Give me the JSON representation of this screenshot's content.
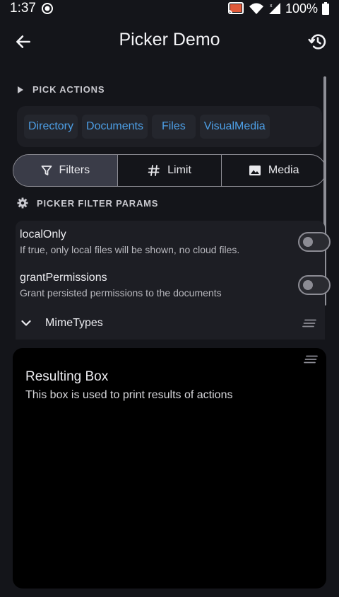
{
  "status_bar": {
    "time": "1:37",
    "battery": "100%"
  },
  "app_bar": {
    "title": "Picker Demo"
  },
  "pick_actions": {
    "header": "PICK ACTIONS",
    "chips": [
      "Directory",
      "Documents",
      "Files",
      "VisualMedia"
    ]
  },
  "segments": [
    {
      "label": "Filters",
      "icon": "filter-icon",
      "selected": true
    },
    {
      "label": "Limit",
      "icon": "hash-icon",
      "selected": false
    },
    {
      "label": "Media",
      "icon": "image-icon",
      "selected": false
    }
  ],
  "filter_params": {
    "header": "PICKER FILTER PARAMS",
    "items": [
      {
        "title": "localOnly",
        "subtitle": "If true, only local files will be shown, no cloud files.",
        "enabled": false
      },
      {
        "title": "grantPermissions",
        "subtitle": "Grant persisted permissions to the documents",
        "enabled": false
      }
    ],
    "mime_label": "MimeTypes"
  },
  "result_box": {
    "title": "Resulting Box",
    "subtitle": "This box is used to print results of actions"
  },
  "colors": {
    "background": "#14151a",
    "card": "#1d1e24",
    "accent": "#4d9fe6",
    "segment_selected": "#3a3c48",
    "result_bg": "#000000"
  }
}
